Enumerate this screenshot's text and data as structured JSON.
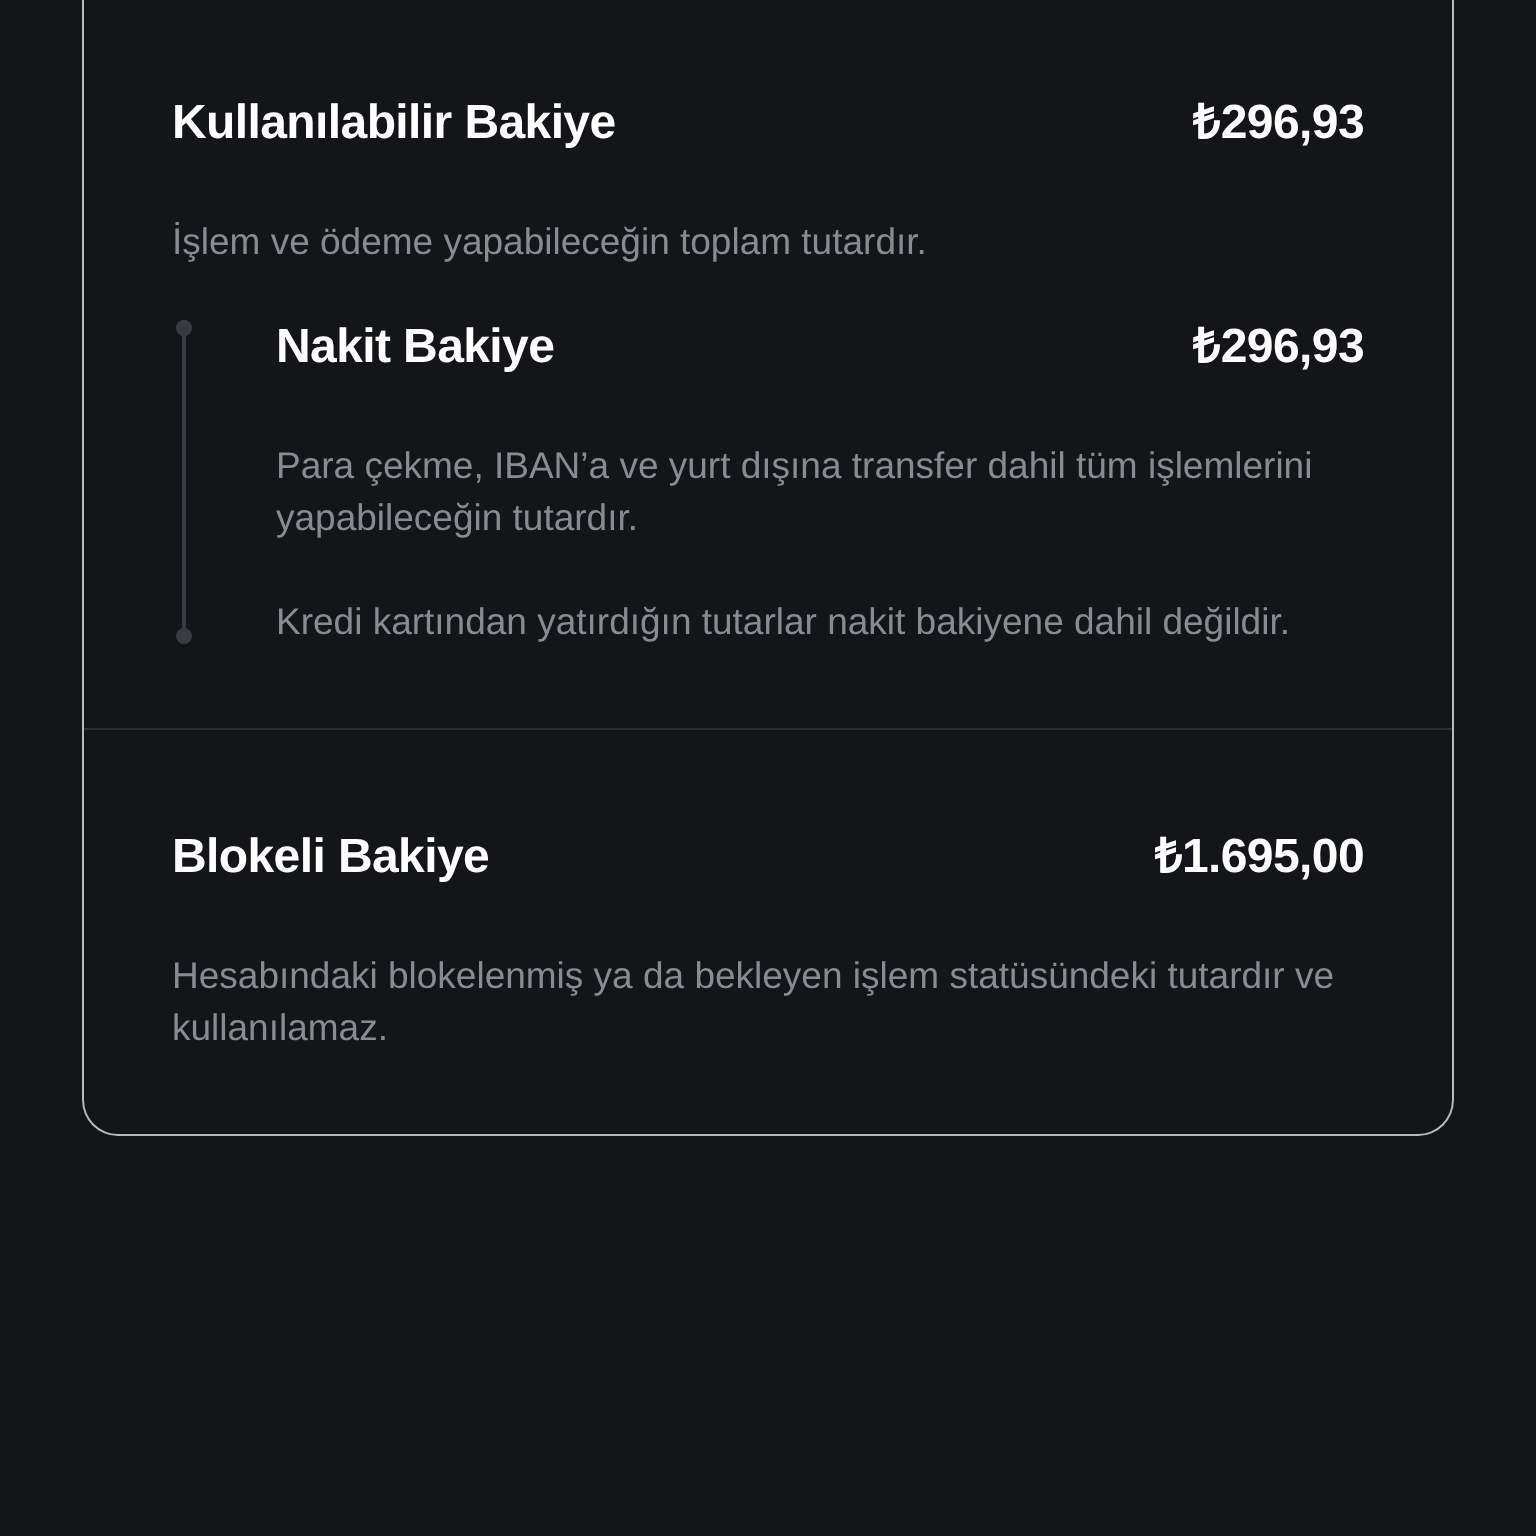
{
  "sections": [
    {
      "title": "Kullanılabilir Bakiye",
      "amount": "₺296,93",
      "description": [
        "İşlem ve ödeme yapabileceğin toplam tutardır."
      ],
      "children": [
        {
          "title": "Nakit Bakiye",
          "amount": "₺296,93",
          "description": [
            "Para çekme, IBAN’a ve yurt dışına transfer dahil tüm işlemlerini yapabileceğin tutardır.",
            "Kredi kartından yatırdığın tutarlar nakit bakiyene dahil değildir."
          ]
        }
      ]
    },
    {
      "title": "Blokeli Bakiye",
      "amount": "₺1.695,00",
      "description": [
        "Hesabındaki blokelenmiş ya da bekleyen işlem statüsündeki tutardır ve kullanılamaz."
      ]
    }
  ]
}
